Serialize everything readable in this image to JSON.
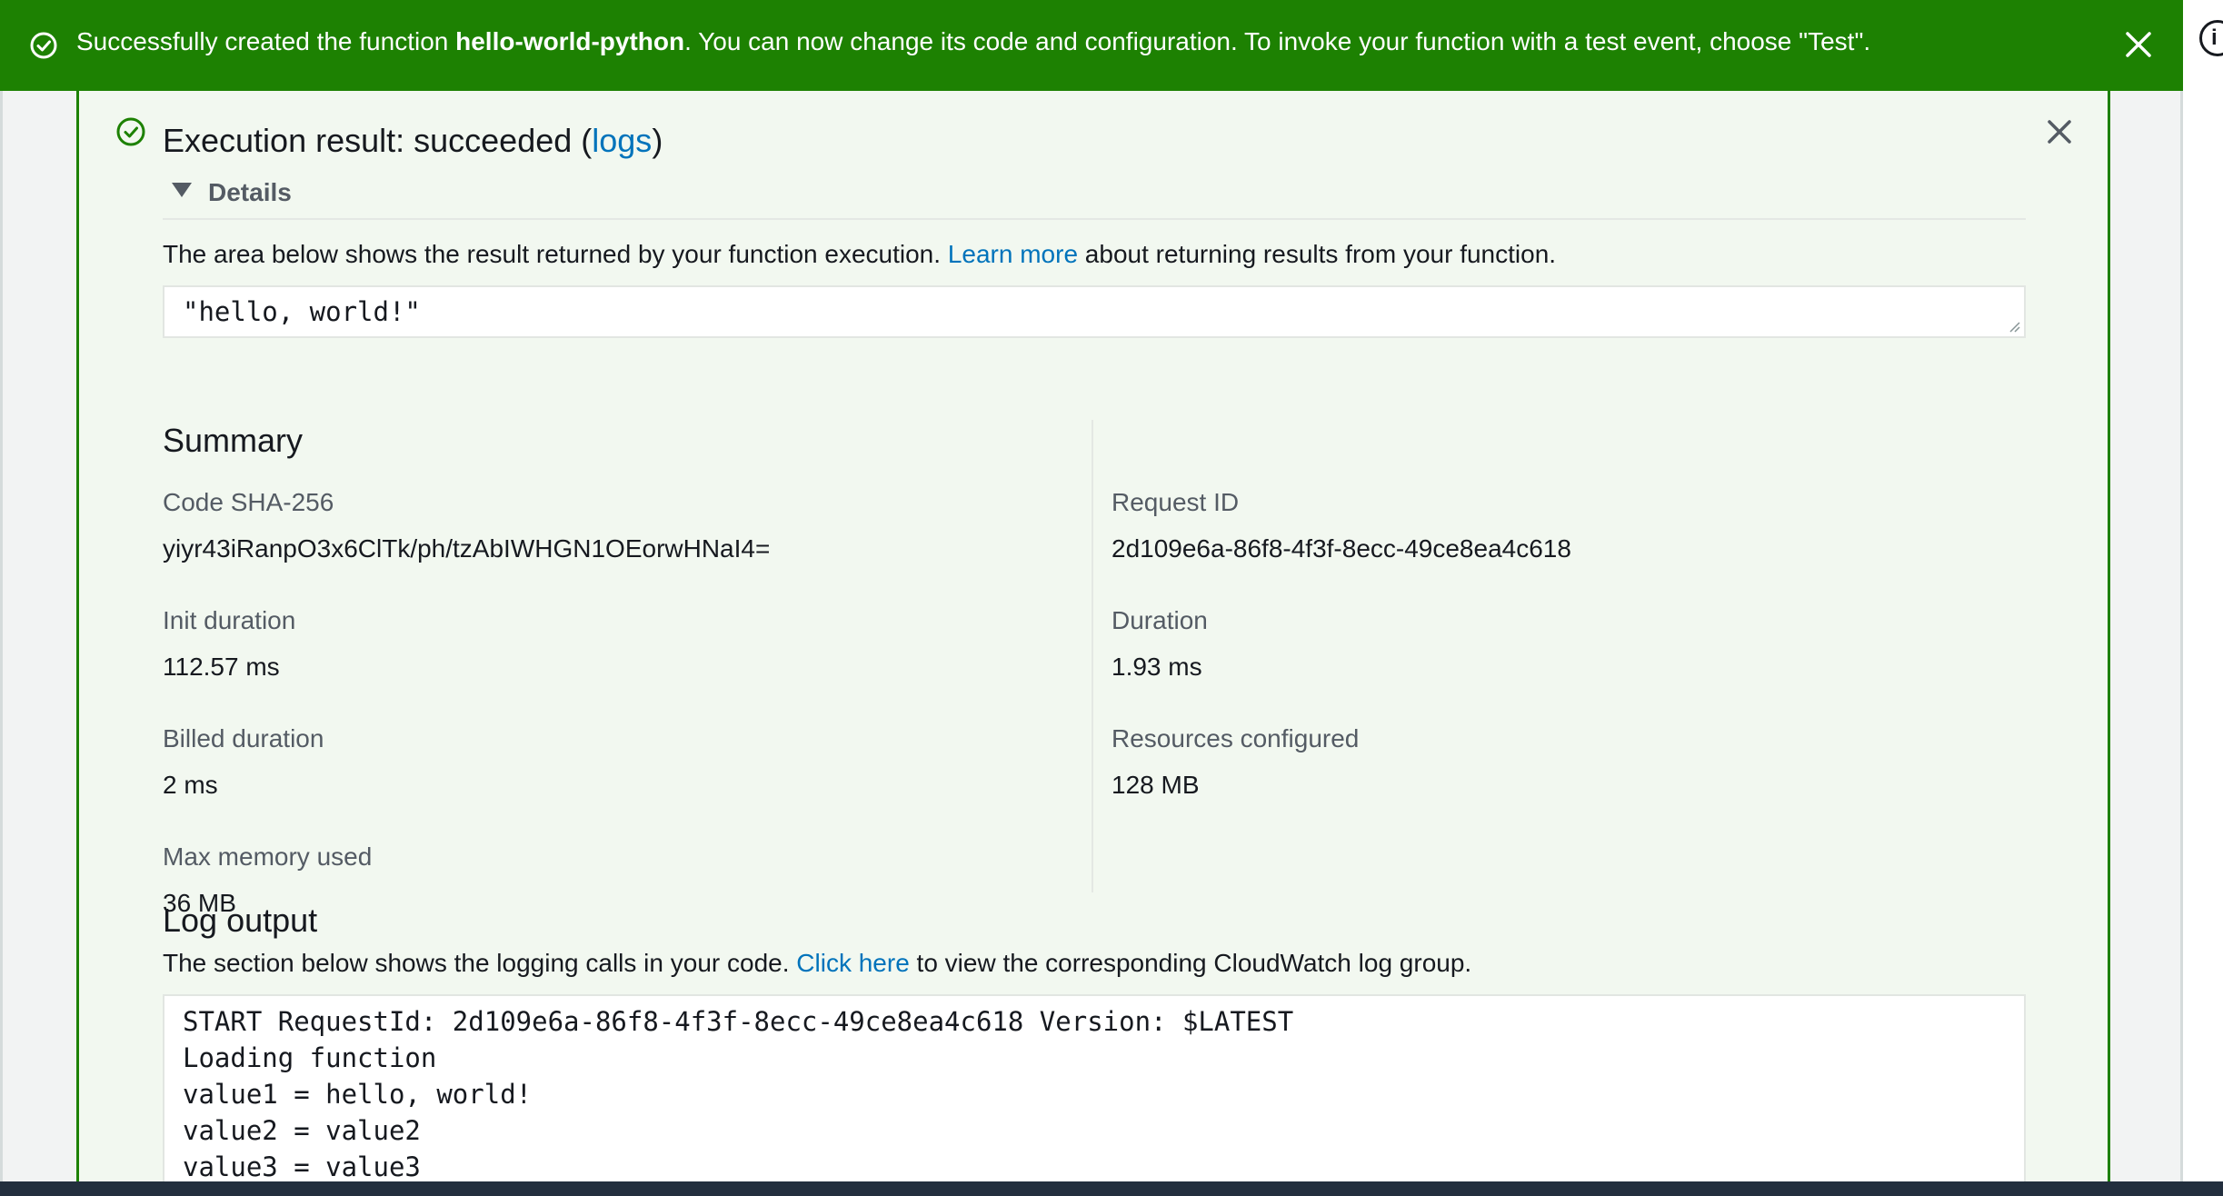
{
  "flash": {
    "prefix": "Successfully created the function ",
    "function_name": "hello-world-python",
    "suffix": ". You can now change its code and configuration. To invoke your function with a test event, choose \"Test\".",
    "color": "#1d8102"
  },
  "result": {
    "title_prefix": "Execution result: succeeded (",
    "title_link": "logs",
    "title_suffix": ")",
    "details_label": "Details",
    "desc_prefix": "The area below shows the result returned by your function execution. ",
    "desc_link": "Learn more",
    "desc_suffix": " about returning results from your function.",
    "output": "\"hello, world!\""
  },
  "summary": {
    "heading": "Summary",
    "code_sha_label": "Code SHA-256",
    "code_sha_value": "yiyr43iRanpO3x6ClTk/ph/tzAbIWHGN1OEorwHNaI4=",
    "request_id_label": "Request ID",
    "request_id_value": "2d109e6a-86f8-4f3f-8ecc-49ce8ea4c618",
    "init_duration_label": "Init duration",
    "init_duration_value": "112.57 ms",
    "duration_label": "Duration",
    "duration_value": "1.93 ms",
    "billed_duration_label": "Billed duration",
    "billed_duration_value": "2 ms",
    "resources_label": "Resources configured",
    "resources_value": "128 MB",
    "max_memory_label": "Max memory used",
    "max_memory_value": "36 MB"
  },
  "log": {
    "heading": "Log output",
    "desc_prefix": "The section below shows the logging calls in your code. ",
    "desc_link": "Click here",
    "desc_suffix": " to view the corresponding CloudWatch log group.",
    "lines": [
      "START RequestId: 2d109e6a-86f8-4f3f-8ecc-49ce8ea4c618 Version: $LATEST",
      "Loading function",
      "value1 = hello, world!",
      "value2 = value2",
      "value3 = value3"
    ]
  },
  "colors": {
    "link": "#0073bb",
    "success": "#1d8102"
  }
}
